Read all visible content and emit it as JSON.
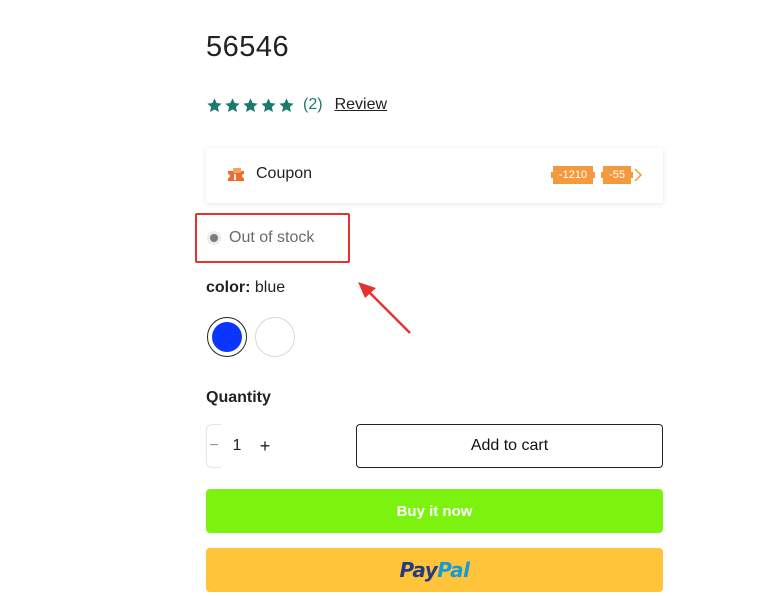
{
  "product": {
    "title": "56546",
    "rating": {
      "stars": 5,
      "count": "(2)",
      "review_label": "Review"
    }
  },
  "coupon": {
    "label": "Coupon",
    "tags": [
      "-1210",
      "-55"
    ]
  },
  "stock": {
    "status": "Out of stock"
  },
  "color": {
    "label": "color:",
    "value": "blue",
    "options": [
      "blue",
      "white"
    ],
    "selected": "blue"
  },
  "quantity": {
    "label": "Quantity",
    "value": "1",
    "minus": "−",
    "plus": "+"
  },
  "buttons": {
    "add_to_cart": "Add to cart",
    "buy_now": "Buy it now",
    "paypal_a": "Pay",
    "paypal_b": "Pal"
  },
  "colors": {
    "star": "#1b7a6b",
    "coupon_tag": "#f39a3f",
    "highlight": "#e6322d",
    "buy_now": "#7cf30e",
    "paypal": "#ffc439",
    "swatch_blue": "#0b36ff"
  }
}
